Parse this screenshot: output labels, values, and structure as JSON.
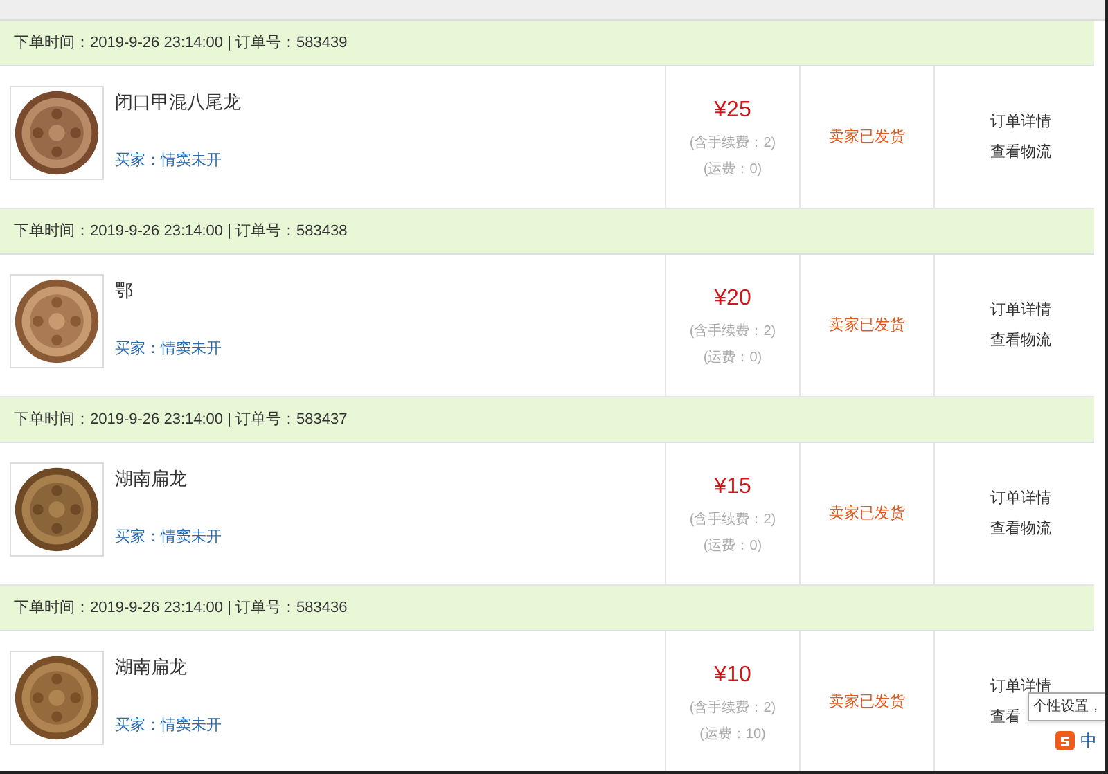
{
  "orders": [
    {
      "meta": "下单时间：2019-9-26 23:14:00 | 订单号：583439",
      "name": "闭口甲混八尾龙",
      "buyer": "买家：情窦未开",
      "price": "¥25",
      "fee": "(含手续费：2)",
      "shipping": "(运费：0)",
      "status": "卖家已发货",
      "actions": [
        "订单详情",
        "查看物流"
      ]
    },
    {
      "meta": "下单时间：2019-9-26 23:14:00 | 订单号：583438",
      "name": "鄂",
      "buyer": "买家：情窦未开",
      "price": "¥20",
      "fee": "(含手续费：2)",
      "shipping": "(运费：0)",
      "status": "卖家已发货",
      "actions": [
        "订单详情",
        "查看物流"
      ]
    },
    {
      "meta": "下单时间：2019-9-26 23:14:00 | 订单号：583437",
      "name": "湖南扁龙",
      "buyer": "买家：情窦未开",
      "price": "¥15",
      "fee": "(含手续费：2)",
      "shipping": "(运费：0)",
      "status": "卖家已发货",
      "actions": [
        "订单详情",
        "查看物流"
      ]
    },
    {
      "meta": "下单时间：2019-9-26 23:14:00 | 订单号：583436",
      "name": "湖南扁龙",
      "buyer": "买家：情窦未开",
      "price": "¥10",
      "fee": "(含手续费：2)",
      "shipping": "(运费：10)",
      "status": "卖家已发货",
      "actions": [
        "订单详情",
        "查看"
      ]
    }
  ],
  "ime": {
    "tooltip": "个性设置，",
    "mode": "中"
  }
}
